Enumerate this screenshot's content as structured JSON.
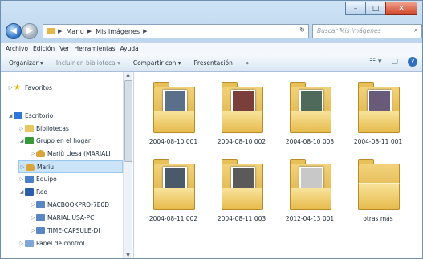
{
  "window": {
    "minimize": "–",
    "maximize": "□",
    "close": "✕"
  },
  "nav": {
    "back": "◀",
    "forward": "▶"
  },
  "address": {
    "segments": [
      "Mariu",
      "Mis imágenes"
    ],
    "refresh": "↻"
  },
  "search": {
    "placeholder": "Buscar Mis imágenes",
    "icon": "⌕"
  },
  "menu": [
    "Archivo",
    "Edición",
    "Ver",
    "Herramientas",
    "Ayuda"
  ],
  "toolbar": {
    "organize": "Organizar ▾",
    "include": "Incluir en biblioteca ▾",
    "share": "Compartir con ▾",
    "slideshow": "Presentación",
    "more": "»",
    "views": "☷ ▾",
    "preview": "▢",
    "help": "?"
  },
  "sidebar": {
    "favorites": "Favoritos",
    "desktop": "Escritorio",
    "libraries": "Bibliotecas",
    "homegroup": "Grupo en el hogar",
    "homegroup_user": "Mariù Liesa (MARIALI",
    "user": "Mariu",
    "computer": "Equipo",
    "network": "Red",
    "net_items": [
      "MACBOOKPRO-7E0D",
      "MARIALIUSA-PC",
      "TIME-CAPSULE-DI"
    ],
    "control_panel": "Panel de control"
  },
  "files": [
    {
      "name": "2004-08-10 001",
      "photo_color": "#5a6f8a"
    },
    {
      "name": "2004-08-10 002",
      "photo_color": "#7a3f3a"
    },
    {
      "name": "2004-08-10 003",
      "photo_color": "#4f6a5a"
    },
    {
      "name": "2004-08-11 001",
      "photo_color": "#6a5a7a"
    },
    {
      "name": "2004-08-11 002",
      "photo_color": "#4a5a6a"
    },
    {
      "name": "2004-08-11 003",
      "photo_color": "#5a5a5a"
    },
    {
      "name": "2012-04-13 001",
      "photo_color": "#c8c8c8"
    },
    {
      "name": "otras más",
      "photo_color": null
    }
  ]
}
